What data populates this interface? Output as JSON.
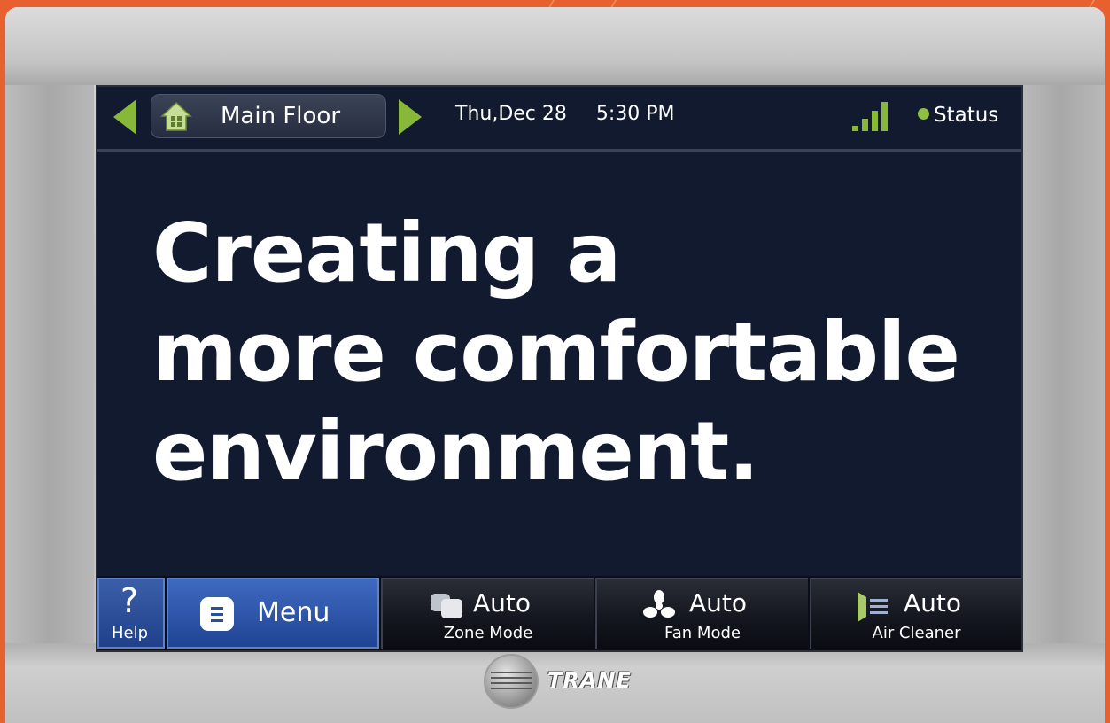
{
  "topbar": {
    "zone_name": "Main Floor",
    "date": "Thu,Dec 28",
    "time": "5:30 PM",
    "status_label": "Status",
    "signal_bars": 4
  },
  "headline": {
    "line1": "Creating a",
    "line2": "more comfortable",
    "line3": "environment."
  },
  "bottombar": {
    "help_symbol": "?",
    "help_label": "Help",
    "menu_label": "Menu",
    "zone_mode": {
      "value": "Auto",
      "label": "Zone Mode"
    },
    "fan_mode": {
      "value": "Auto",
      "label": "Fan Mode"
    },
    "air_cleaner": {
      "value": "Auto",
      "label": "Air Cleaner"
    }
  },
  "brand": {
    "logo_text": "TRANE"
  },
  "colors": {
    "accent_green": "#88b83a",
    "screen_bg": "#121a30",
    "menu_blue": "#2f58aa",
    "bezel_orange": "#e8602e"
  }
}
